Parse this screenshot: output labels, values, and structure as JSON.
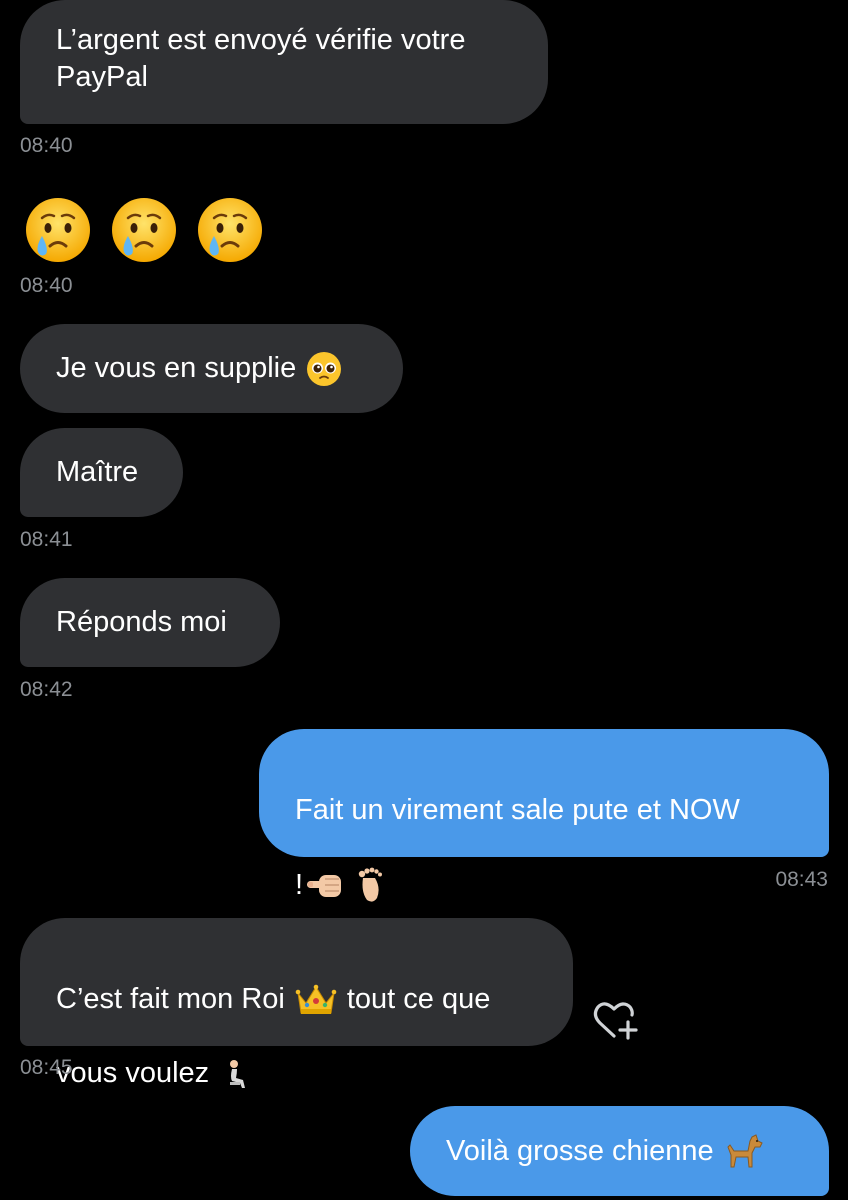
{
  "colors": {
    "background": "#000000",
    "incoming_bubble": "#2f3033",
    "outgoing_bubble": "#4a99e9",
    "timestamp": "#8b8f94"
  },
  "messages": [
    {
      "direction": "incoming",
      "text": "L’argent est envoyé vérifie votre\nPayPal",
      "time": "08:40"
    },
    {
      "direction": "incoming",
      "emojis": [
        "crying-face-icon",
        "crying-face-icon",
        "crying-face-icon"
      ],
      "time": "08:40"
    },
    {
      "direction": "incoming",
      "text": "Je vous en supplie",
      "emoji": "pleading-face-icon"
    },
    {
      "direction": "incoming",
      "text": "Maître",
      "time": "08:41"
    },
    {
      "direction": "incoming",
      "text": "Réponds moi",
      "time": "08:42"
    },
    {
      "direction": "outgoing",
      "text_line1": "Fait un virement sale pute et NOW",
      "text_line2": "!",
      "emojis": [
        "pointing-hand-icon",
        "foot-icon"
      ],
      "time": "08:43"
    },
    {
      "direction": "incoming",
      "text_part1": "C’est fait mon Roi",
      "text_part2": "tout ce que",
      "text_line2": "vous voulez",
      "emojis": [
        "crown-icon",
        "kneeling-person-icon"
      ],
      "time": "08:45",
      "reaction_button": "add-reaction-heart-icon"
    },
    {
      "direction": "outgoing",
      "text": "Voilà grosse chienne",
      "emoji": "dog-icon"
    }
  ]
}
